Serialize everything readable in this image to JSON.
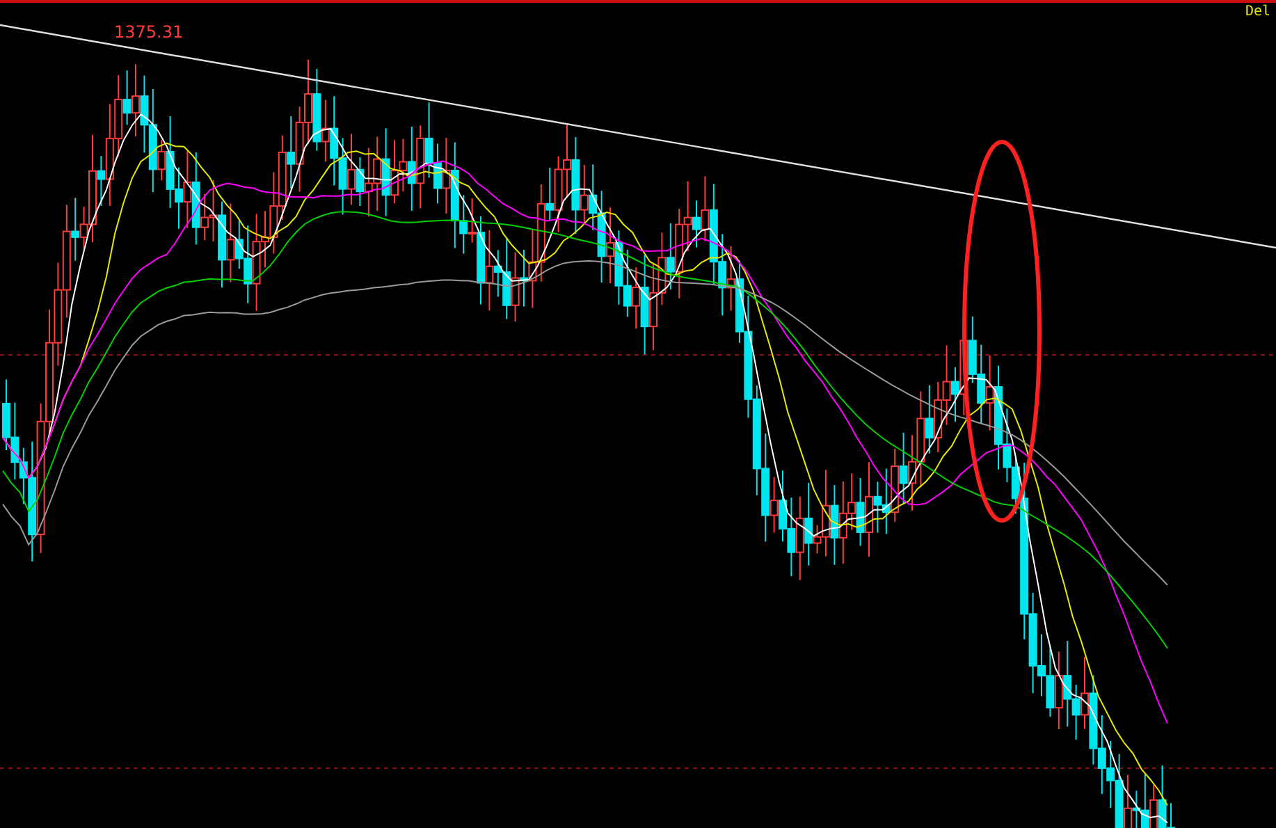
{
  "chart": {
    "peak_label": "1375.31",
    "corner_label": "Del"
  }
}
